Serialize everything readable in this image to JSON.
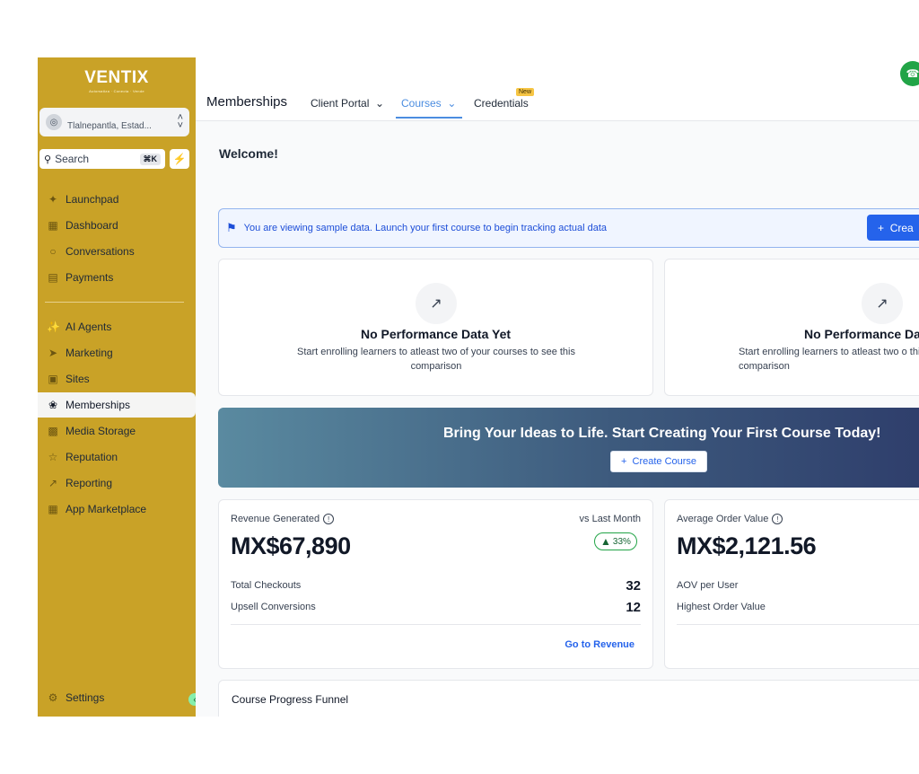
{
  "sidebar": {
    "logo": "VENTIX",
    "logo_tagline": "Automatiza · Conecta · Vende",
    "location": "Tlalnepantla, Estad...",
    "search_label": "Search",
    "search_shortcut": "⌘K",
    "items": [
      {
        "label": "Launchpad",
        "icon": "rocket-icon"
      },
      {
        "label": "Dashboard",
        "icon": "grid-icon"
      },
      {
        "label": "Conversations",
        "icon": "chat-icon"
      },
      {
        "label": "Payments",
        "icon": "receipt-icon"
      },
      {
        "label": "AI Agents",
        "icon": "sparkle-icon"
      },
      {
        "label": "Marketing",
        "icon": "send-icon"
      },
      {
        "label": "Sites",
        "icon": "browser-icon"
      },
      {
        "label": "Memberships",
        "icon": "award-icon"
      },
      {
        "label": "Media Storage",
        "icon": "image-icon"
      },
      {
        "label": "Reputation",
        "icon": "star-icon"
      },
      {
        "label": "Reporting",
        "icon": "trend-icon"
      },
      {
        "label": "App Marketplace",
        "icon": "apps-icon"
      }
    ],
    "settings_label": "Settings"
  },
  "header": {
    "title": "Memberships",
    "tabs": [
      {
        "label": "Client Portal"
      },
      {
        "label": "Courses"
      },
      {
        "label": "Credentials"
      }
    ],
    "new_badge": "New"
  },
  "main": {
    "welcome": "Welcome!",
    "banner_text": "You are viewing sample data. Launch your first course to begin tracking actual data",
    "banner_button": "Crea",
    "perf_card": {
      "title": "No Performance Data Yet",
      "desc": "Start enrolling learners to atleast two of your courses to see this comparison"
    },
    "perf_card2": {
      "title": "No Performance Da",
      "desc": "Start enrolling learners to atleast two o this comparison"
    },
    "hero_title": "Bring Your Ideas to Life. Start Creating Your First Course Today!",
    "hero_button": "Create Course",
    "revenue": {
      "label": "Revenue Generated",
      "compare": "vs Last Month",
      "value": "MX$67,890",
      "change": "33%",
      "rows": [
        {
          "label": "Total Checkouts",
          "value": "32"
        },
        {
          "label": "Upsell Conversions",
          "value": "12"
        }
      ],
      "link": "Go to Revenue"
    },
    "aov": {
      "label": "Average Order Value",
      "value": "MX$2,121.56",
      "rows": [
        {
          "label": "AOV per User"
        },
        {
          "label": "Highest Order Value"
        }
      ]
    },
    "funnel_title": "Course Progress Funnel"
  }
}
